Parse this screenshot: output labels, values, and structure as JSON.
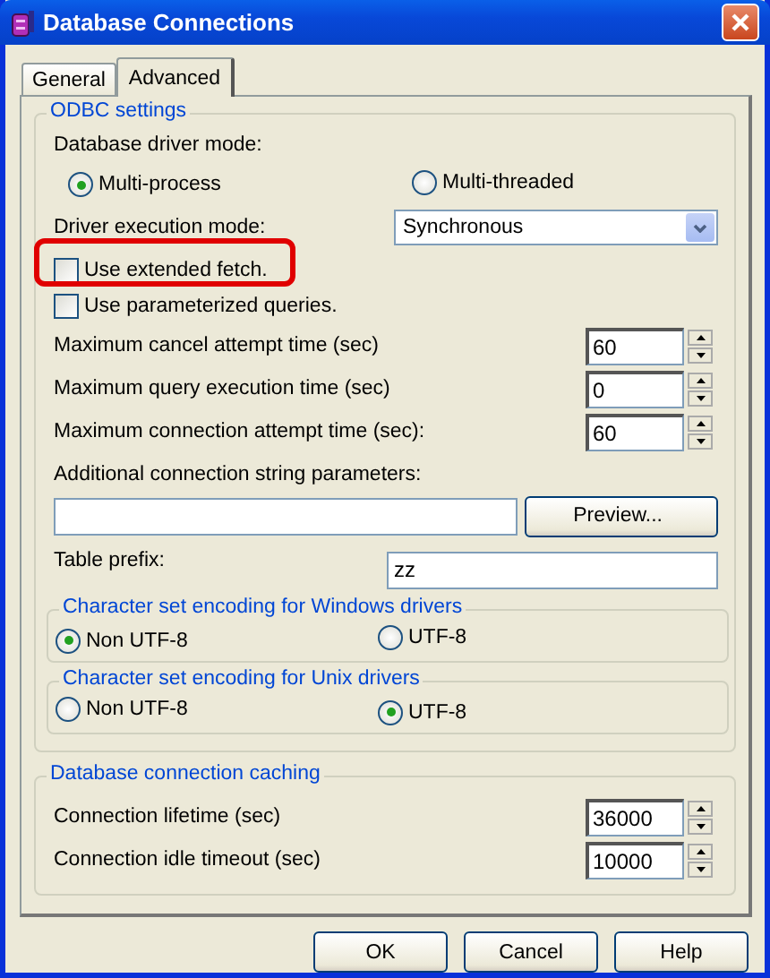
{
  "window": {
    "title": "Database Connections"
  },
  "tabs": [
    {
      "label": "General",
      "selected": false
    },
    {
      "label": "Advanced",
      "selected": true
    }
  ],
  "odbc_settings": {
    "title": "ODBC settings",
    "driver_mode": {
      "label": "Database driver mode:",
      "options": [
        {
          "label": "Multi-process",
          "selected": true
        },
        {
          "label": "Multi-threaded",
          "selected": false
        }
      ]
    },
    "execution_mode": {
      "label": "Driver execution mode:",
      "value": "Synchronous"
    },
    "checkboxes": [
      {
        "label": "Use extended fetch.",
        "checked": false,
        "highlighted": true
      },
      {
        "label": "Use parameterized queries.",
        "checked": false,
        "highlighted": false
      }
    ],
    "timeouts": [
      {
        "label": "Maximum cancel attempt time (sec)",
        "value": "60"
      },
      {
        "label": "Maximum query execution time (sec)",
        "value": "0"
      },
      {
        "label": "Maximum connection attempt time (sec):",
        "value": "60"
      }
    ],
    "connection_string": {
      "label": "Additional connection string parameters:",
      "button": "Preview..."
    },
    "table_prefix": {
      "label": "Table prefix:",
      "value": "zz"
    },
    "encodings": [
      {
        "title": "Character set encoding for Windows drivers",
        "options": [
          {
            "label": "Non UTF-8",
            "selected": true
          },
          {
            "label": "UTF-8",
            "selected": false
          }
        ]
      },
      {
        "title": "Character set encoding for Unix drivers",
        "options": [
          {
            "label": "Non UTF-8",
            "selected": false
          },
          {
            "label": "UTF-8",
            "selected": true
          }
        ]
      }
    ]
  },
  "caching": {
    "title": "Database connection caching",
    "fields": [
      {
        "label": "Connection lifetime (sec)",
        "value": "36000"
      },
      {
        "label": "Connection idle timeout (sec)",
        "value": "10000"
      }
    ]
  },
  "buttons": [
    "OK",
    "Cancel",
    "Help"
  ]
}
